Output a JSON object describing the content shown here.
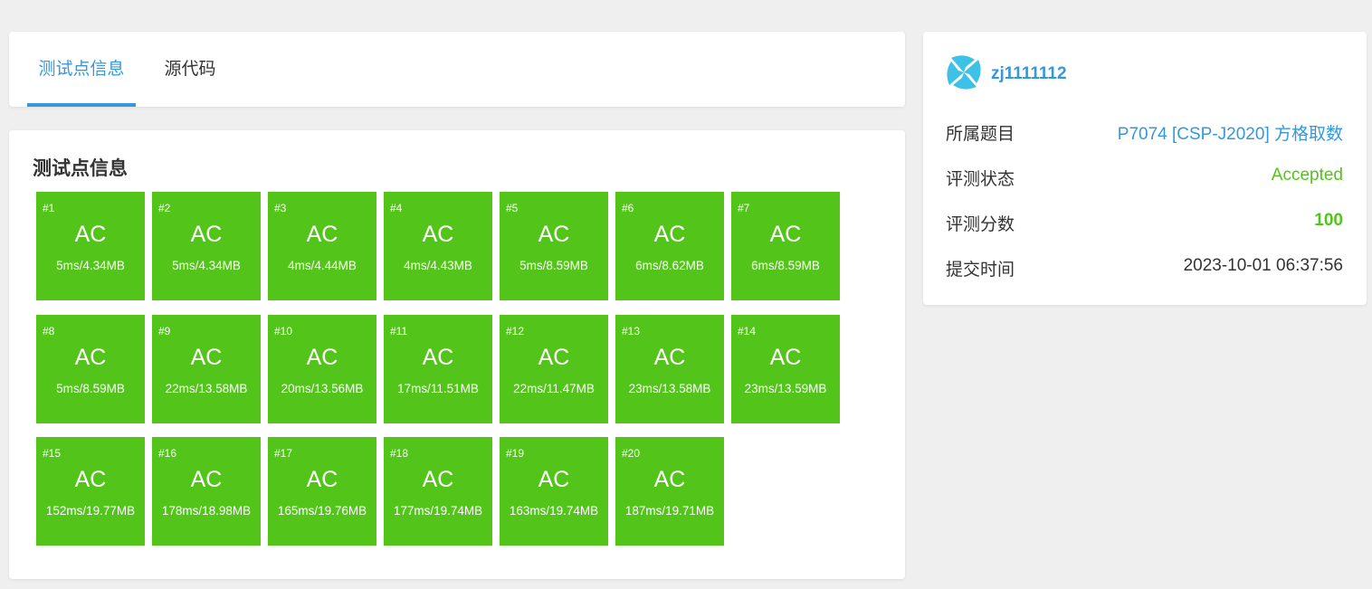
{
  "tabs": [
    {
      "label": "测试点信息",
      "active": true
    },
    {
      "label": "源代码",
      "active": false
    }
  ],
  "section_title": "测试点信息",
  "accent_color": "#3498db",
  "ac_color": "#52c41a",
  "cases": [
    {
      "num": "#1",
      "status": "AC",
      "result": "5ms/4.34MB"
    },
    {
      "num": "#2",
      "status": "AC",
      "result": "5ms/4.34MB"
    },
    {
      "num": "#3",
      "status": "AC",
      "result": "4ms/4.44MB"
    },
    {
      "num": "#4",
      "status": "AC",
      "result": "4ms/4.43MB"
    },
    {
      "num": "#5",
      "status": "AC",
      "result": "5ms/8.59MB"
    },
    {
      "num": "#6",
      "status": "AC",
      "result": "6ms/8.62MB"
    },
    {
      "num": "#7",
      "status": "AC",
      "result": "6ms/8.59MB"
    },
    {
      "num": "#8",
      "status": "AC",
      "result": "5ms/8.59MB"
    },
    {
      "num": "#9",
      "status": "AC",
      "result": "22ms/13.58MB"
    },
    {
      "num": "#10",
      "status": "AC",
      "result": "20ms/13.56MB"
    },
    {
      "num": "#11",
      "status": "AC",
      "result": "17ms/11.51MB"
    },
    {
      "num": "#12",
      "status": "AC",
      "result": "22ms/11.47MB"
    },
    {
      "num": "#13",
      "status": "AC",
      "result": "23ms/13.58MB"
    },
    {
      "num": "#14",
      "status": "AC",
      "result": "23ms/13.59MB"
    },
    {
      "num": "#15",
      "status": "AC",
      "result": "152ms/19.77MB"
    },
    {
      "num": "#16",
      "status": "AC",
      "result": "178ms/18.98MB"
    },
    {
      "num": "#17",
      "status": "AC",
      "result": "165ms/19.76MB"
    },
    {
      "num": "#18",
      "status": "AC",
      "result": "177ms/19.74MB"
    },
    {
      "num": "#19",
      "status": "AC",
      "result": "163ms/19.74MB"
    },
    {
      "num": "#20",
      "status": "AC",
      "result": "187ms/19.71MB"
    }
  ],
  "info": {
    "username": "zj1111112",
    "avatar_icon": "user-avatar-icon",
    "rows": {
      "problem": {
        "label": "所属题目",
        "value": "P7074 [CSP-J2020] 方格取数"
      },
      "status": {
        "label": "评测状态",
        "value": "Accepted"
      },
      "score": {
        "label": "评测分数",
        "value": "100"
      },
      "time": {
        "label": "提交时间",
        "value": "2023-10-01 06:37:56"
      }
    }
  }
}
